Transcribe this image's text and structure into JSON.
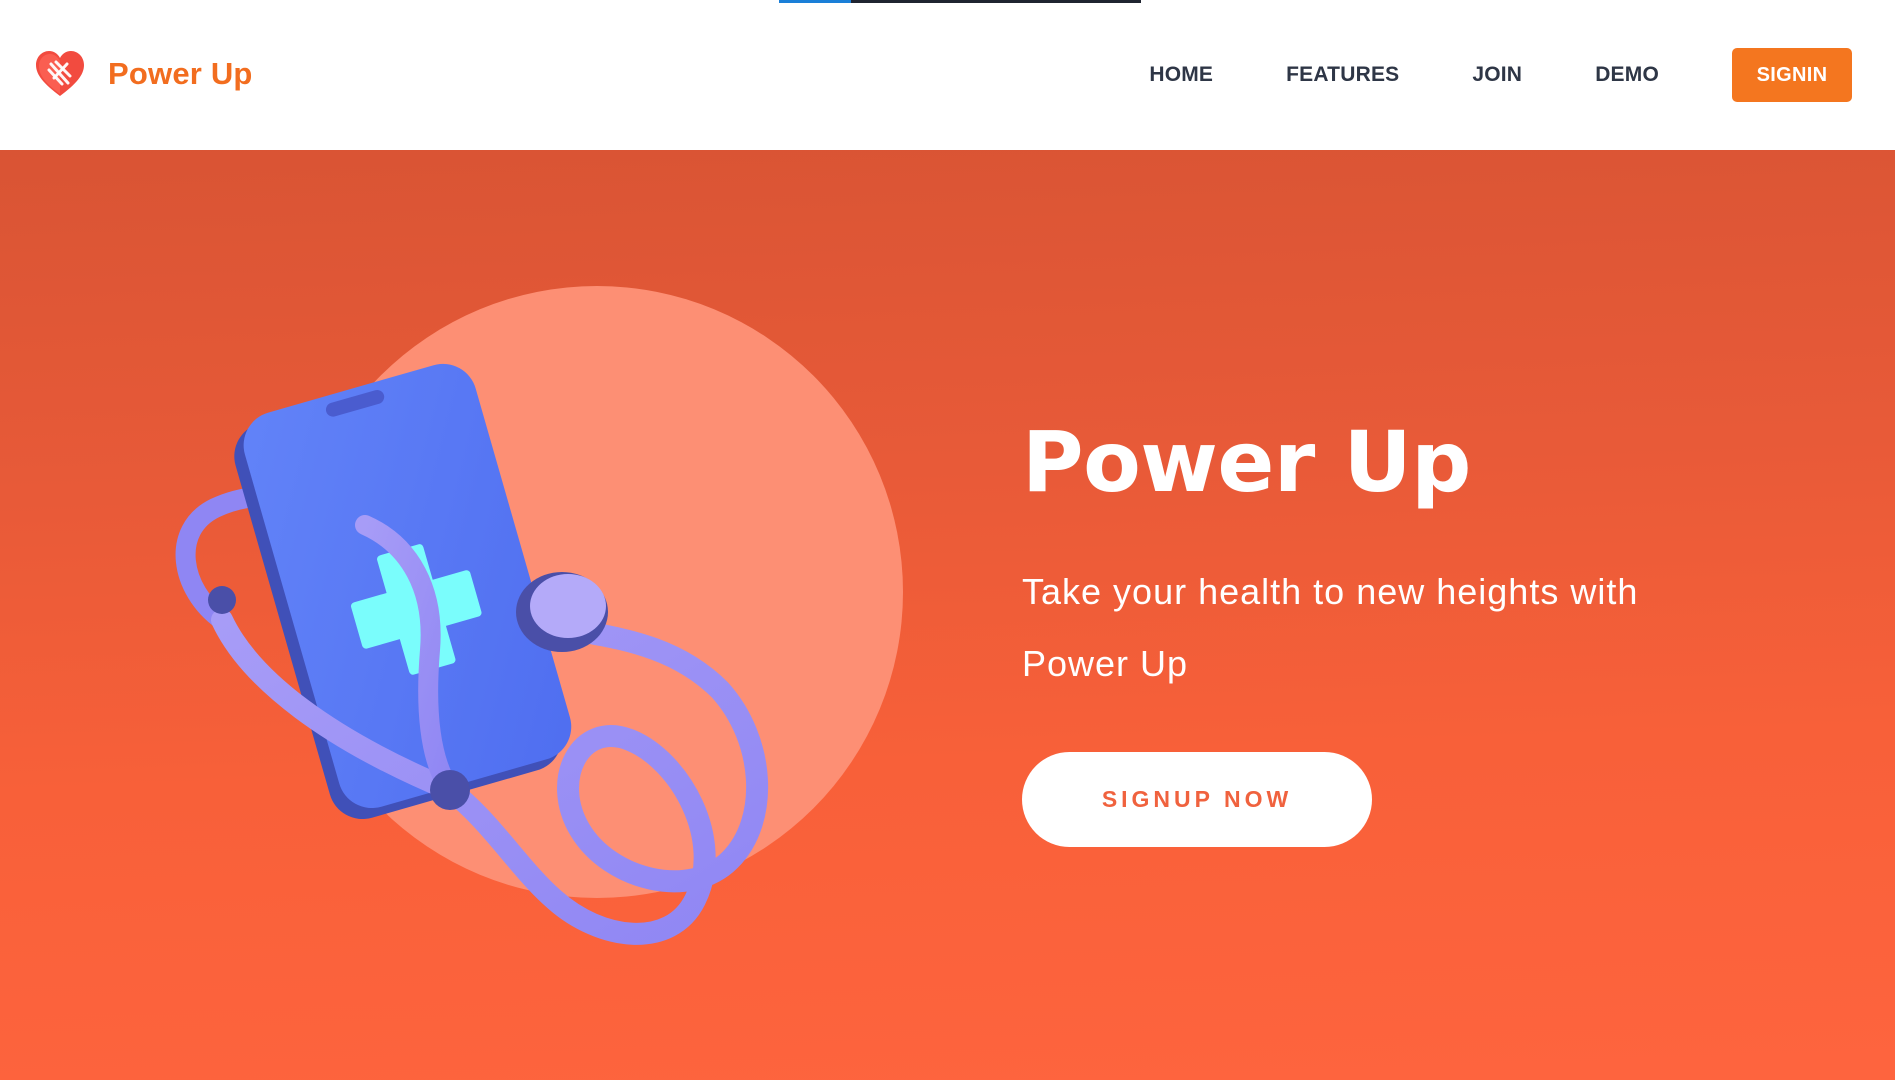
{
  "app": {
    "brand_name": "Power Up",
    "logo_icon": "heart-pulse-logo-icon"
  },
  "loading_bar": {
    "progress_fraction": 0.2
  },
  "nav": {
    "items": [
      {
        "label": "HOME"
      },
      {
        "label": "FEATURES"
      },
      {
        "label": "JOIN"
      },
      {
        "label": "DEMO"
      }
    ],
    "signin_label": "SIGNIN"
  },
  "hero": {
    "title": "Power Up",
    "subtitle": "Take your health to new heights with Power Up",
    "cta_label": "SIGNUP NOW",
    "illustration": "phone-with-stethoscope-illustration"
  },
  "colors": {
    "brand_orange": "#f26d1f",
    "signin_bg": "#f4761f",
    "nav_text": "#2e3646",
    "hero_bg_top": "#d95434",
    "hero_bg_bottom": "#fe643e",
    "hero_circle": "#fd8f74",
    "phone_blue": "#5b7af7",
    "stethoscope_purple": "#9a8ff5",
    "cross_cyan": "#7afdfc",
    "progress_blue": "#1a7fd8"
  }
}
